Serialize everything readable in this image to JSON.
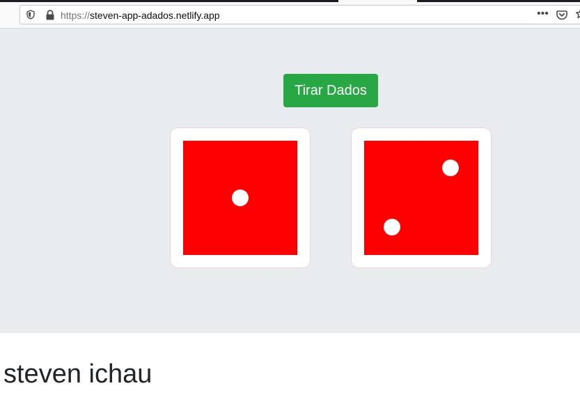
{
  "browser": {
    "url_protocol": "https://",
    "url_host": "steven-app-adados.netlify.app",
    "icons": [
      "shield-icon",
      "lock-icon",
      "more-dots-icon",
      "pocket-icon",
      "star-icon"
    ]
  },
  "app": {
    "roll_button_label": "Tirar Dados",
    "dice": [
      {
        "value": 1,
        "face_color": "#ff0000",
        "pip_color": "#ffffff"
      },
      {
        "value": 2,
        "face_color": "#ff0000",
        "pip_color": "#ffffff"
      }
    ],
    "accent_color": "#28a745",
    "background_color": "#e9ecef"
  },
  "footer": {
    "name": "steven ichau"
  }
}
